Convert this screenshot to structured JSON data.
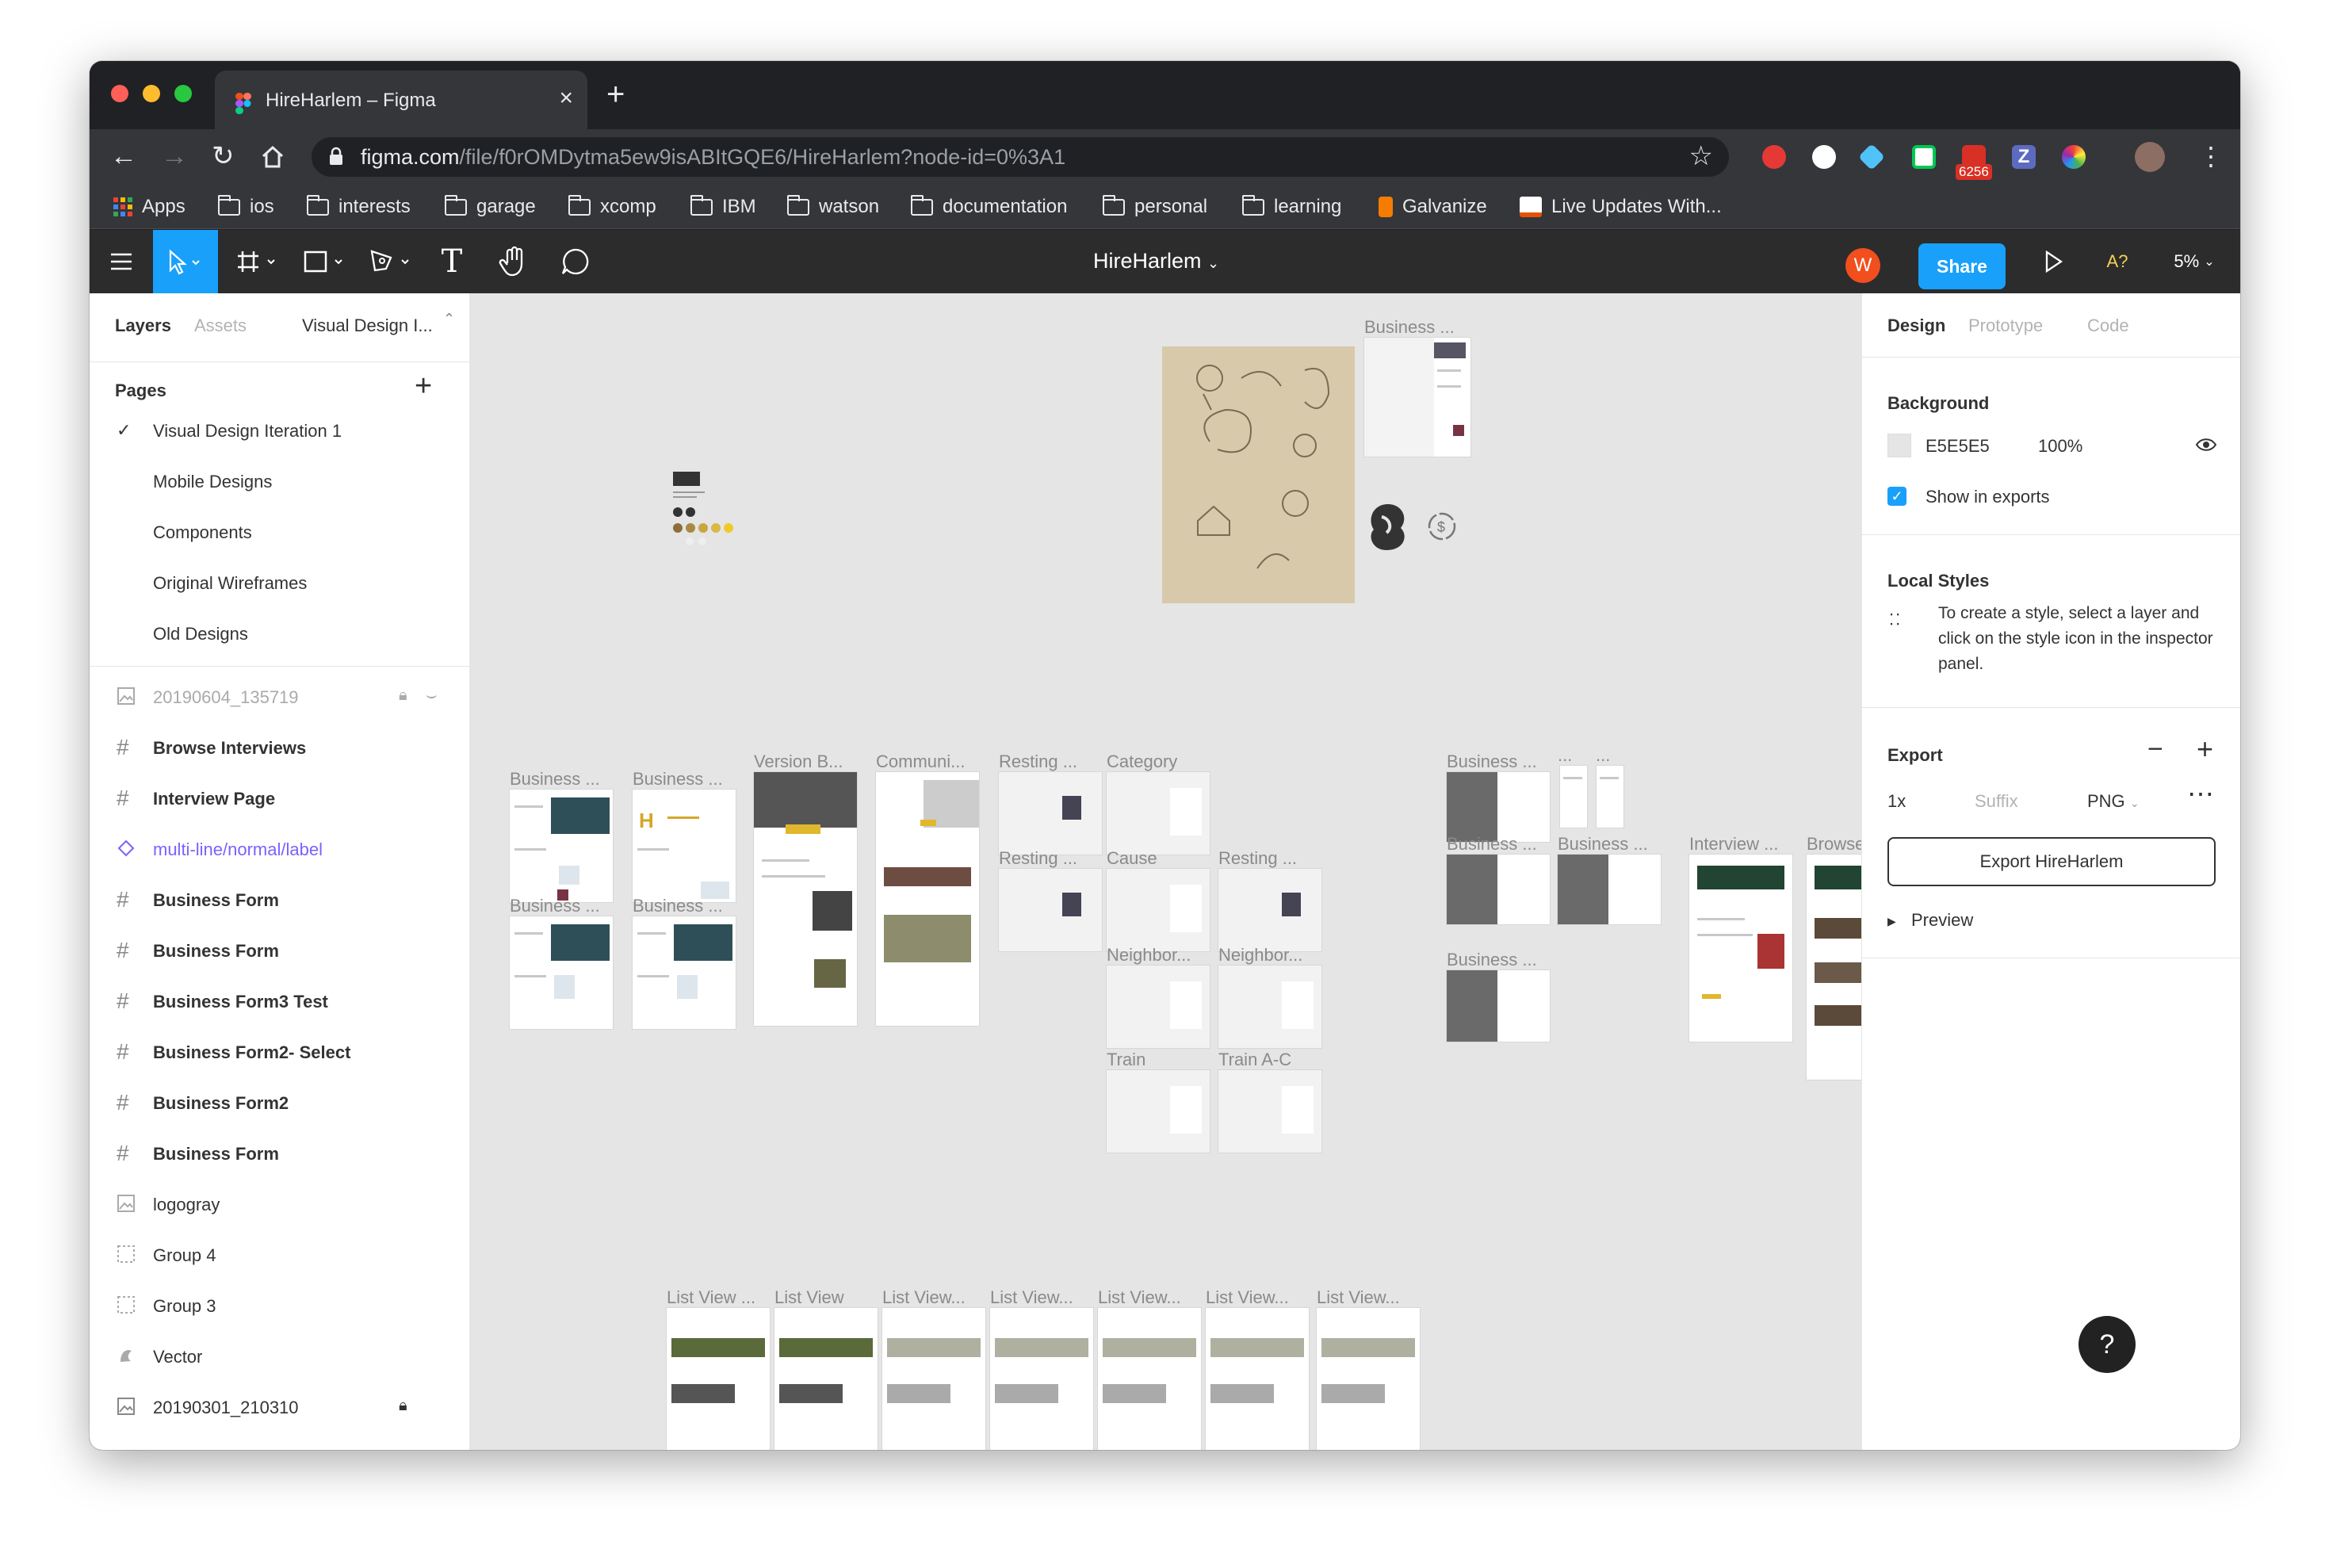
{
  "browser": {
    "tab_title": "HireHarlem – Figma",
    "url_host": "figma.com",
    "url_path": "/file/f0rOMDytma5ew9isABItGQE6/HireHarlem?node-id=0%3A1",
    "ext_badge": "6256",
    "bookmarks": [
      "Apps",
      "ios",
      "interests",
      "garage",
      "xcomp",
      "IBM",
      "watson",
      "documentation",
      "personal",
      "learning",
      "Galvanize",
      "Live Updates With..."
    ]
  },
  "figma": {
    "file_title": "HireHarlem",
    "avatar_letter": "W",
    "share_label": "Share",
    "font_warning": "A?",
    "zoom": "5%"
  },
  "left_panel": {
    "tabs": [
      "Layers",
      "Assets"
    ],
    "page_selector": "Visual Design I...",
    "pages_title": "Pages",
    "pages": [
      "Visual Design Iteration 1",
      "Mobile Designs",
      "Components",
      "Original Wireframes",
      "Old Designs"
    ],
    "layers": [
      {
        "label": "20190604_135719",
        "icon": "image-icon"
      },
      {
        "label": "Browse Interviews",
        "icon": "frame-icon"
      },
      {
        "label": "Interview Page",
        "icon": "frame-icon"
      },
      {
        "label": "multi-line/normal/label",
        "icon": "component-icon"
      },
      {
        "label": "Business Form",
        "icon": "frame-icon"
      },
      {
        "label": "Business Form",
        "icon": "frame-icon"
      },
      {
        "label": "Business Form3 Test",
        "icon": "frame-icon"
      },
      {
        "label": "Business Form2- Select",
        "icon": "frame-icon"
      },
      {
        "label": "Business Form2",
        "icon": "frame-icon"
      },
      {
        "label": "Business Form",
        "icon": "frame-icon"
      },
      {
        "label": "logogray",
        "icon": "image-icon"
      },
      {
        "label": "Group 4",
        "icon": "group-icon"
      },
      {
        "label": "Group 3",
        "icon": "group-icon"
      },
      {
        "label": "Vector",
        "icon": "vector-icon"
      },
      {
        "label": "20190301_210310",
        "icon": "image-icon"
      }
    ]
  },
  "canvas": {
    "frame_labels": {
      "business_top_right": "Business ...",
      "b1": "Business ...",
      "b2": "Business ...",
      "b3": "Business ...",
      "b4": "Business ...",
      "version": "Version B...",
      "community": "Communi...",
      "resting1": "Resting ...",
      "category": "Category",
      "resting2": "Resting ...",
      "cause": "Cause",
      "resting3": "Resting ...",
      "neighbor1": "Neighbor...",
      "neighbor2": "Neighbor...",
      "train": "Train",
      "train_ac": "Train A-C",
      "bus_r1": "Business ...",
      "dots1": "...",
      "dots2": "...",
      "bus_r2": "Business ...",
      "bus_r3": "Business ...",
      "bus_r4": "Business ...",
      "interview": "Interview ...",
      "browse": "Browse In...",
      "lv1": "List View ...",
      "lv2": "List View",
      "lv3": "List View...",
      "lv4": "List View...",
      "lv5": "List View...",
      "lv6": "List View...",
      "lv7": "List View..."
    }
  },
  "right_panel": {
    "tabs": [
      "Design",
      "Prototype",
      "Code"
    ],
    "background_title": "Background",
    "bg_hex": "E5E5E5",
    "bg_opacity": "100%",
    "show_in_exports": "Show in exports",
    "local_styles_title": "Local Styles",
    "local_styles_hint": "To create a style, select a layer and click on the style icon in the inspector panel.",
    "export_title": "Export",
    "export_scale": "1x",
    "export_suffix_placeholder": "Suffix",
    "export_format": "PNG",
    "export_button": "Export HireHarlem",
    "preview_label": "Preview"
  },
  "help_label": "?"
}
